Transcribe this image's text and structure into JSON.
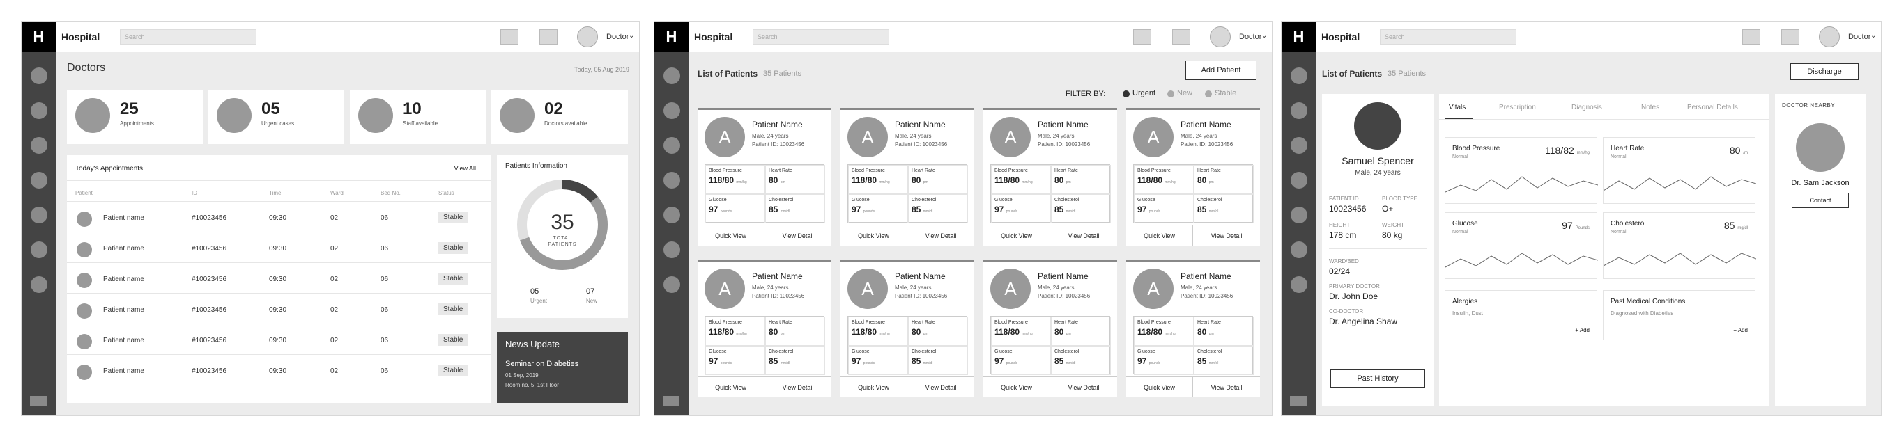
{
  "panel1": {
    "logo": "H",
    "brand": "Hospital",
    "search_placeholder": "Search",
    "user": "Doctor",
    "title": "Doctors",
    "date": "Today, 05 Aug 2019",
    "stats": [
      {
        "value": "25",
        "label": "Appointments"
      },
      {
        "value": "05",
        "label": "Urgent cases"
      },
      {
        "value": "10",
        "label": "Staff available"
      },
      {
        "value": "02",
        "label": "Doctors available"
      }
    ],
    "appointments": {
      "title": "Today's Appointments",
      "view_all": "View All",
      "columns": [
        "Patient",
        "ID",
        "Time",
        "Ward",
        "Bed No.",
        "Status"
      ],
      "rows": [
        {
          "name": "Patient name",
          "id": "#10023456",
          "time": "09:30",
          "ward": "02",
          "bed": "06",
          "status": "Stable"
        },
        {
          "name": "Patient name",
          "id": "#10023456",
          "time": "09:30",
          "ward": "02",
          "bed": "06",
          "status": "Stable"
        },
        {
          "name": "Patient name",
          "id": "#10023456",
          "time": "09:30",
          "ward": "02",
          "bed": "06",
          "status": "Stable"
        },
        {
          "name": "Patient name",
          "id": "#10023456",
          "time": "09:30",
          "ward": "02",
          "bed": "06",
          "status": "Stable"
        },
        {
          "name": "Patient name",
          "id": "#10023456",
          "time": "09:30",
          "ward": "02",
          "bed": "06",
          "status": "Stable"
        },
        {
          "name": "Patient name",
          "id": "#10023456",
          "time": "09:30",
          "ward": "02",
          "bed": "06",
          "status": "Stable"
        }
      ]
    },
    "patients_info": {
      "title": "Patients Information",
      "total": "35",
      "total_label_1": "TOTAL",
      "total_label_2": "PATIENTS",
      "urgent_value": "05",
      "urgent_label": "Urgent",
      "new_value": "07",
      "new_label": "New",
      "urgent_fraction": 0.1429
    },
    "news": {
      "title": "News Update",
      "headline": "Seminar on Diabeties",
      "date": "01 Sep, 2019",
      "location": "Room no. 5, 1st Floor"
    }
  },
  "panel2": {
    "logo": "H",
    "brand": "Hospital",
    "search_placeholder": "Search",
    "user": "Doctor",
    "title": "List of Patients",
    "count": "35 Patients",
    "add_button": "Add Patient",
    "filter_label": "FILTER BY:",
    "filters": [
      "Urgent",
      "New",
      "Stable"
    ],
    "card": {
      "avatar": "A",
      "name": "Patient Name",
      "meta": "Male, 24 years",
      "pid": "Patient ID: 10023456",
      "bp_label": "Blood Pressure",
      "bp_value": "118/80",
      "bp_unit": "mm/hg",
      "hr_label": "Heart Rate",
      "hr_value": "80",
      "hr_unit": "pm",
      "gl_label": "Glucose",
      "gl_value": "97",
      "gl_unit": "pounds",
      "ch_label": "Cholesterol",
      "ch_value": "85",
      "ch_unit": "mm/dl",
      "quick_view": "Quick View",
      "view_detail": "View Detail"
    }
  },
  "panel3": {
    "logo": "H",
    "brand": "Hospital",
    "search_placeholder": "Search",
    "user": "Doctor",
    "title": "List of Patients",
    "count": "35 Patients",
    "discharge": "Discharge",
    "patient": {
      "name": "Samuel Spencer",
      "meta": "Male, 24 years",
      "id_label": "PATIENT ID",
      "id": "10023456",
      "blood_label": "BLOOD TYPE",
      "blood": "O+",
      "height_label": "HEIGHT",
      "height": "178 cm",
      "weight_label": "WEIGHT",
      "weight": "80 kg",
      "ward_label": "WARD/BED",
      "ward": "02/24",
      "doctor_label": "PRIMARY DOCTOR",
      "doctor": "Dr. John Doe",
      "codoctor_label": "CO-DOCTOR",
      "codoctor": "Dr. Angelina Shaw",
      "past_history": "Past History"
    },
    "tabs": [
      "Vitals",
      "Prescription",
      "Diagnosis",
      "Notes",
      "Personal Details"
    ],
    "vitals": [
      {
        "title": "Blood Pressure",
        "status": "Normal",
        "value": "118/82",
        "unit": "mm/hg"
      },
      {
        "title": "Heart Rate",
        "status": "Normal",
        "value": "80",
        "unit": "/m"
      },
      {
        "title": "Glucose",
        "status": "Normal",
        "value": "97",
        "unit": "Pounds"
      },
      {
        "title": "Cholesterol",
        "status": "Normal",
        "value": "85",
        "unit": "mg/dl"
      }
    ],
    "allergies": {
      "title": "Alergies",
      "text": "Insulin, Dust",
      "add": "+ Add"
    },
    "conditions": {
      "title": "Past Medical Conditions",
      "text": "Diagnosed with Diabeties",
      "add": "+ Add"
    },
    "nearby": {
      "title": "DOCTOR NEARBY",
      "name": "Dr. Sam Jackson",
      "contact": "Contact"
    }
  }
}
